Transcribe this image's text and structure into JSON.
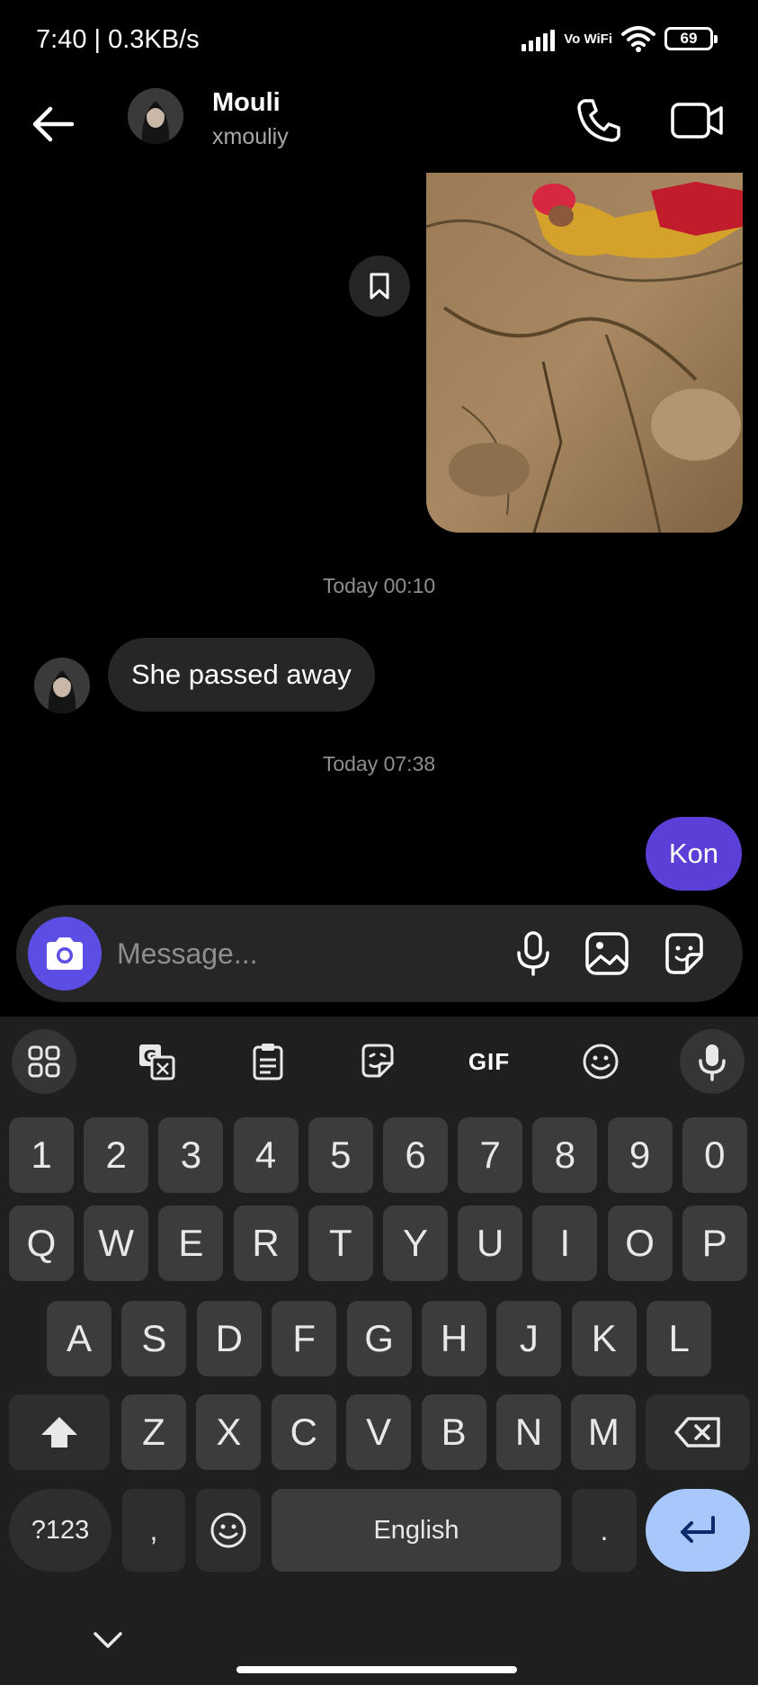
{
  "status_bar": {
    "time": "7:40 | 0.3KB/s",
    "vowifi": "Vo WiFi",
    "battery": "69"
  },
  "header": {
    "name": "Mouli",
    "username": "xmouliy"
  },
  "messages": {
    "ts1": "Today 00:10",
    "incoming": "She passed away",
    "ts2": "Today 07:38",
    "outgoing": "Kon"
  },
  "composer": {
    "placeholder": "Message..."
  },
  "keyboard": {
    "toolbar_gif": "GIF",
    "numbers": [
      "1",
      "2",
      "3",
      "4",
      "5",
      "6",
      "7",
      "8",
      "9",
      "0"
    ],
    "row1": [
      "Q",
      "W",
      "E",
      "R",
      "T",
      "Y",
      "U",
      "I",
      "O",
      "P"
    ],
    "row2": [
      "A",
      "S",
      "D",
      "F",
      "G",
      "H",
      "J",
      "K",
      "L"
    ],
    "row3": [
      "Z",
      "X",
      "C",
      "V",
      "B",
      "N",
      "M"
    ],
    "symbols_key": "?123",
    "comma_key": ",",
    "space_key": "English",
    "period_key": "."
  },
  "colors": {
    "accent": "#5c4de5",
    "outgoing_bubble": "#5b3fd6",
    "enter_key": "#a8c7fa"
  }
}
